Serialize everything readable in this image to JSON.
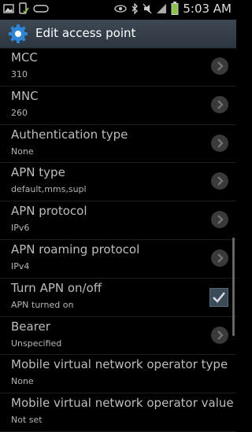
{
  "status_bar": {
    "time": "5:03 AM",
    "battery_color": "#8bc34a"
  },
  "action_bar": {
    "title": "Edit access point"
  },
  "items": [
    {
      "title": "MCC",
      "summary": "310",
      "control": "chevron"
    },
    {
      "title": "MNC",
      "summary": "260",
      "control": "chevron"
    },
    {
      "title": "Authentication type",
      "summary": "None",
      "control": "chevron"
    },
    {
      "title": "APN type",
      "summary": "default,mms,supl",
      "control": "chevron"
    },
    {
      "title": "APN protocol",
      "summary": "IPv6",
      "control": "chevron"
    },
    {
      "title": "APN roaming protocol",
      "summary": "IPv4",
      "control": "chevron"
    },
    {
      "title": "Turn APN on/off",
      "summary": "APN turned on",
      "control": "checkbox",
      "checked": true
    },
    {
      "title": "Bearer",
      "summary": "Unspecified",
      "control": "chevron"
    },
    {
      "title": "Mobile virtual network operator type",
      "summary": "None",
      "control": "none"
    },
    {
      "title": "Mobile virtual network operator value",
      "summary": "Not set",
      "control": "none"
    }
  ]
}
